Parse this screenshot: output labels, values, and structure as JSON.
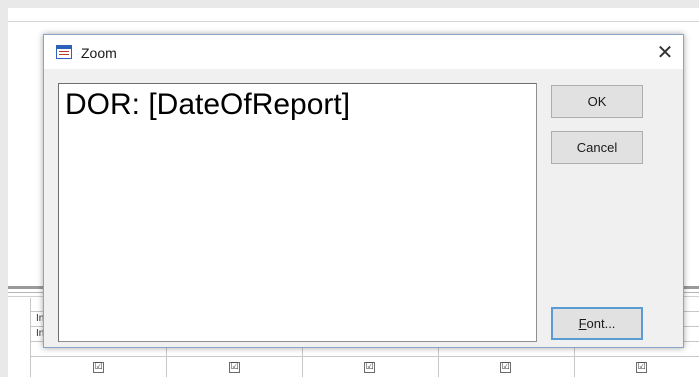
{
  "background": {
    "row_labels": [
      "In",
      "In"
    ],
    "checkbox_mark": "☑",
    "checkbox_count": 5
  },
  "dialog": {
    "title": "Zoom",
    "title_icon": "form-icon",
    "close_glyph": "✕",
    "text_value": "DOR: [DateOfReport]",
    "buttons": {
      "ok_label": "OK",
      "cancel_label": "Cancel",
      "font_label_accel": "F",
      "font_label_rest": "ont..."
    }
  },
  "colors": {
    "dialog_border": "#8aa4c6",
    "focus_border": "#5a9bd5",
    "icon_blue": "#2e62b8"
  }
}
